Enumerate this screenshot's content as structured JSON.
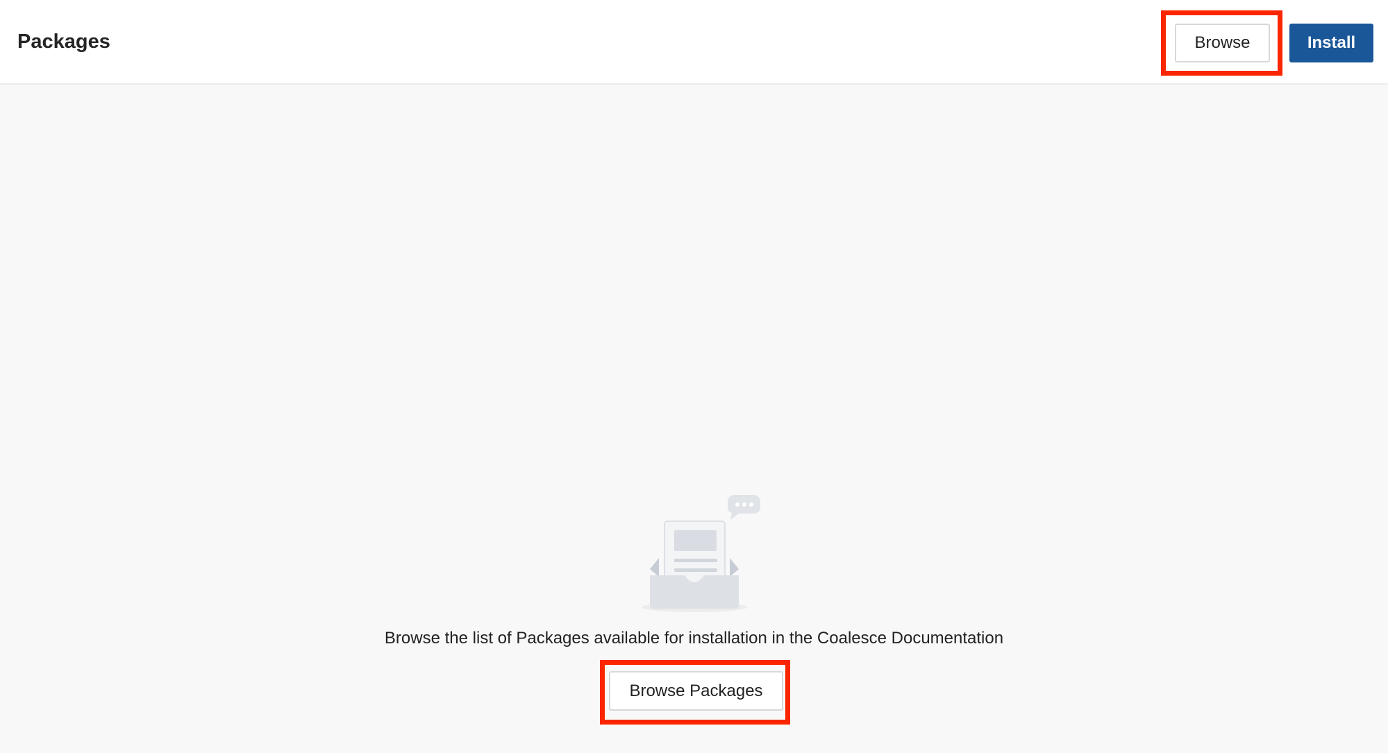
{
  "header": {
    "title": "Packages",
    "browse_label": "Browse",
    "install_label": "Install"
  },
  "empty_state": {
    "icon": "empty-inbox-document-chat-icon",
    "message": "Browse the list of Packages available for installation in the Coalesce Documentation",
    "browse_packages_label": "Browse Packages"
  },
  "colors": {
    "primary": "#1a5799",
    "highlight": "#fb2500",
    "background": "#f8f8f8",
    "header_background": "#ffffff"
  }
}
